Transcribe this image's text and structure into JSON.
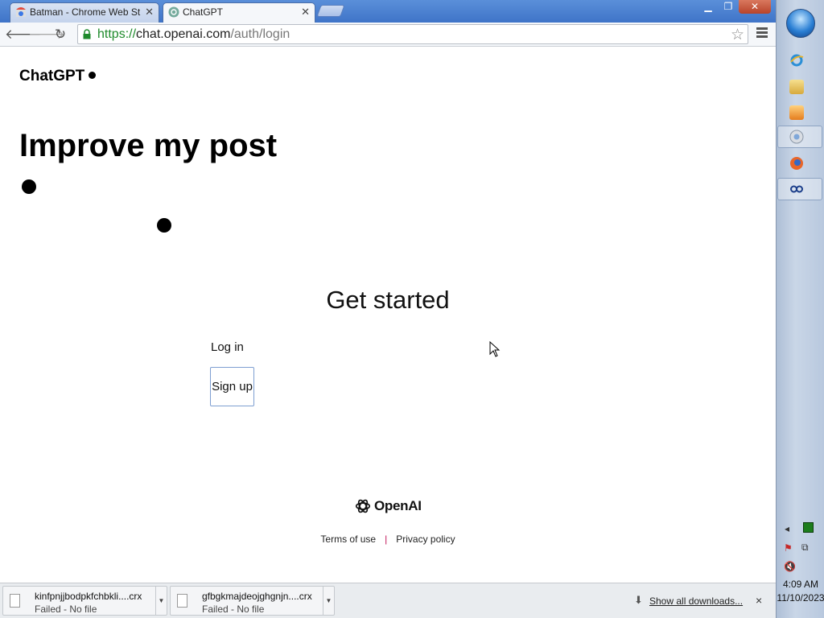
{
  "browser": {
    "tabs": [
      {
        "title": "Batman - Chrome Web St",
        "icon": "chrome-web-store-icon",
        "active": false
      },
      {
        "title": "ChatGPT",
        "icon": "chatgpt-icon",
        "active": true
      }
    ],
    "url": {
      "scheme": "https://",
      "host": "chat.openai.com",
      "path": "/auth/login"
    }
  },
  "page": {
    "brand": "ChatGPT",
    "headline": "Improve my post",
    "get_started": "Get started",
    "login_label": "Log in",
    "signup_label": "Sign up",
    "logo_text": "OpenAI",
    "footer": {
      "terms": "Terms of use",
      "separator": "|",
      "privacy": "Privacy policy"
    }
  },
  "downloads": {
    "items": [
      {
        "name": "kinfpnjjbodpkfchbkli....crx",
        "status": "Failed - No file"
      },
      {
        "name": "gfbgkmajdeojghgnjn....crx",
        "status": "Failed - No file"
      }
    ],
    "show_all": "Show all downloads...",
    "close": "×"
  },
  "taskbar": {
    "time": "4:09 AM",
    "date": "11/10/2023",
    "icons": [
      "start-orb-icon",
      "internet-explorer-icon",
      "file-explorer-icon",
      "media-player-icon",
      "chrome-icon",
      "firefox-icon",
      "app-icon"
    ]
  },
  "colors": {
    "accent_blue": "#4a7fd4",
    "secure_green": "#1e8a2b",
    "separator_pink": "#c2185b"
  }
}
